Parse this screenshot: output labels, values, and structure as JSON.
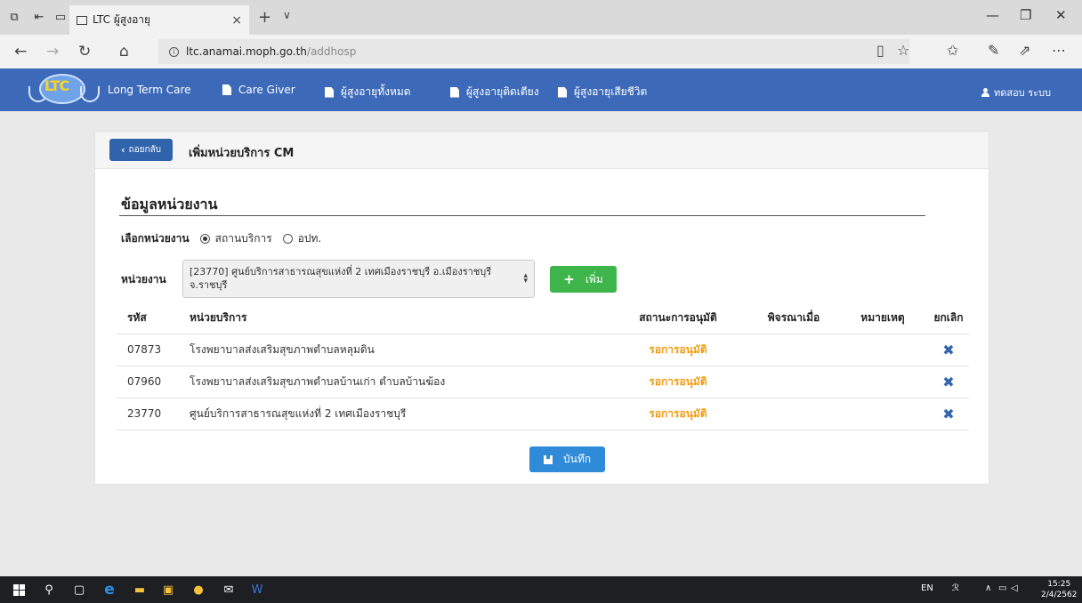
{
  "browser": {
    "tab_title": "LTC ผู้สูงอายุ",
    "tab_close": "×",
    "new_tab": "+",
    "tab_menu": "∨",
    "url_host": "ltc.anamai.moph.go.th",
    "url_path": "/addhosp",
    "win_minimize": "—",
    "win_restore": "❐",
    "win_close": "✕"
  },
  "navbar": {
    "logo_text": "LTC",
    "items": [
      {
        "label": "Long Term Care",
        "icon": ""
      },
      {
        "label": "Care Giver",
        "icon": "document-icon"
      },
      {
        "label": "ผู้สูงอายุทั้งหมด",
        "icon": "document-icon"
      },
      {
        "label": "ผู้สูงอายุติดเตียง",
        "icon": "document-icon"
      },
      {
        "label": "ผู้สูงอายุเสียชีวิต",
        "icon": "document-icon"
      }
    ],
    "user_label": "ทดสอบ ระบบ"
  },
  "panel": {
    "back_label": "ถอยกลับ",
    "title": "เพิ่มหน่วยบริการ CM",
    "section_title": "ข้อมูลหน่วยงาน",
    "choose_label": "เลือกหน่วยงาน",
    "option_1": "สถานบริการ",
    "option_2": "อปท.",
    "unit_label": "หน่วยงาน",
    "unit_value": "[23770] ศูนย์บริการสาธารณสุขแห่งที่ 2 เทศเมืองราชบุรี อ.เมืองราชบุรี จ.ราชบุรี",
    "add_label": "เพิ่ม",
    "save_label": "บันทึก"
  },
  "table": {
    "headers": [
      "รหัส",
      "หน่วยบริการ",
      "สถานะการอนุมัติ",
      "พิจรณาเมื่อ",
      "หมายเหตุ",
      "ยกเลิก"
    ],
    "rows": [
      {
        "code": "07873",
        "name": "โรงพยาบาลส่งเสริมสุขภาพตำบลหลุมดิน",
        "status": "รอการอนุมัติ",
        "considered": "",
        "note": "",
        "cancel": "✖"
      },
      {
        "code": "07960",
        "name": "โรงพยาบาลส่งเสริมสุขภาพตำบลบ้านเก่า ตำบลบ้านฆ้อง",
        "status": "รอการอนุมัติ",
        "considered": "",
        "note": "",
        "cancel": "✖"
      },
      {
        "code": "23770",
        "name": "ศูนย์บริการสาธารณสุขแห่งที่ 2 เทศเมืองราชบุรี",
        "status": "รอการอนุมัติ",
        "considered": "",
        "note": "",
        "cancel": "✖"
      }
    ]
  },
  "taskbar": {
    "lang": "EN",
    "time": "15:25",
    "date": "2/4/2562"
  },
  "colors": {
    "navbar": "#3c69b8",
    "status_pending": "#f39c12",
    "add_button": "#3eb54a",
    "save_button": "#2f8bd8",
    "back_button": "#2f64ad"
  }
}
